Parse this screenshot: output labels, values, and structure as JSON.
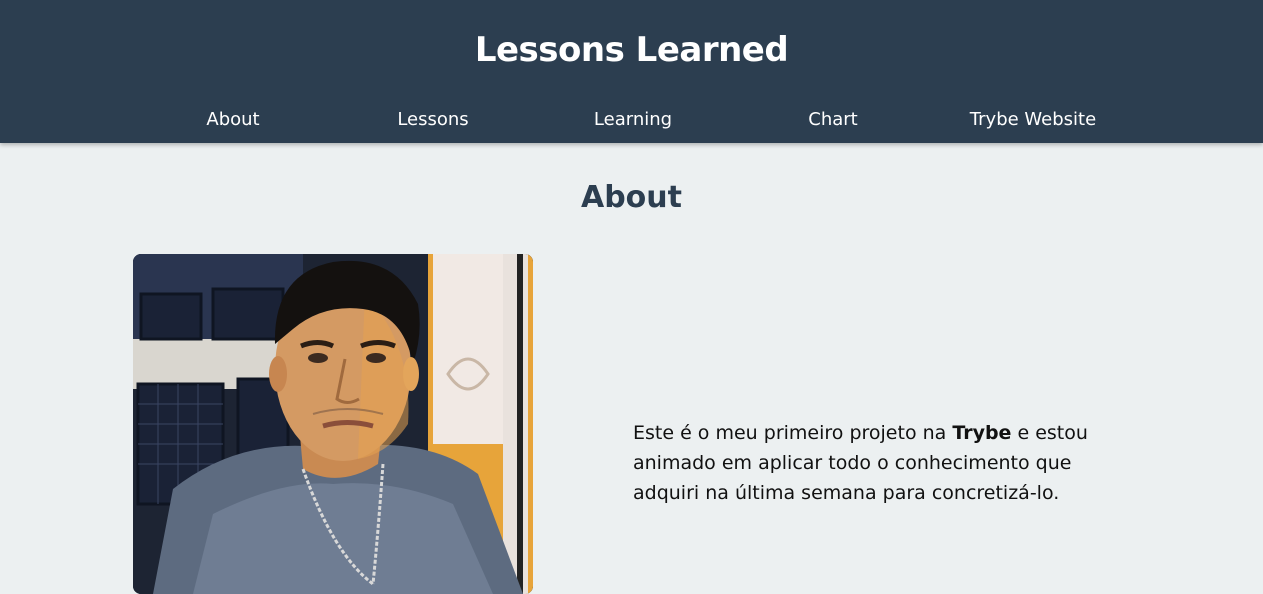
{
  "header": {
    "title": "Lessons Learned"
  },
  "nav": {
    "items": [
      {
        "label": "About"
      },
      {
        "label": "Lessons"
      },
      {
        "label": "Learning"
      },
      {
        "label": "Chart"
      },
      {
        "label": "Trybe Website"
      }
    ]
  },
  "about": {
    "heading": "About",
    "text_before": "Este é o meu primeiro projeto na ",
    "text_bold": "Trybe",
    "text_after": " e estou animado em aplicar todo o conhecimento que adquiri na última semana para concretizá-lo."
  },
  "colors": {
    "header_bg": "#2c3e50",
    "page_bg": "#ecf0f1",
    "heading": "#2c3e50"
  }
}
